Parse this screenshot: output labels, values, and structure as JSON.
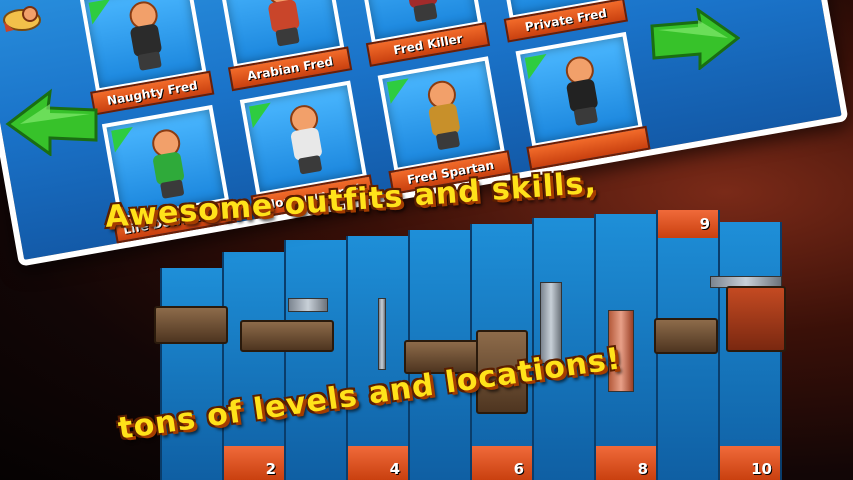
{
  "outfits": [
    {
      "label": "Naughty Fred",
      "color": "#2b2b2b"
    },
    {
      "label": "Arabian Fred",
      "color": "#c9452a"
    },
    {
      "label": "Fred Killer",
      "color": "#a12b2b"
    },
    {
      "label": "Private Fred",
      "color": "#3f7a2a"
    },
    {
      "label": "Life Down Shirt",
      "color": "#2faa3a"
    },
    {
      "label": "Homerun Fred",
      "color": "#e8e8e8"
    },
    {
      "label": "Fred Spartan",
      "color": "#c8902a"
    },
    {
      "label": "",
      "color": "#222222"
    }
  ],
  "captions": {
    "top": "Awesome outfits and skills,",
    "bottom": "tons of levels and locations!"
  },
  "levels": {
    "bottom_numbers": [
      "2",
      "4",
      "6",
      "8",
      "10"
    ],
    "top_number": "9"
  },
  "colors": {
    "panel": "#1a73c9",
    "label": "#e0561f",
    "arrow": "#37c22a",
    "caption": "#ffe21a"
  },
  "icons": {
    "arrow_right": "arrow-right-icon",
    "arrow_left": "arrow-left-icon",
    "logo": "fred-logo-icon"
  }
}
